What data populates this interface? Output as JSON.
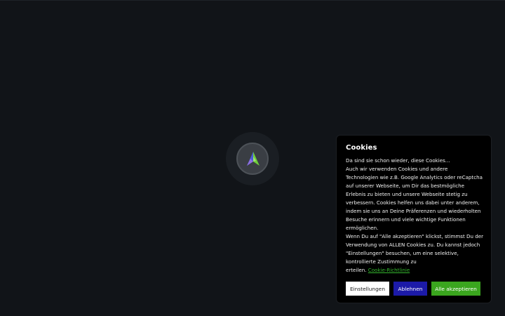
{
  "cookie_banner": {
    "title": "Cookies",
    "lines": [
      "Da sind sie schon wieder, diese Cookies...",
      "Auch wir verwenden Cookies und andere",
      "Technologien wie z.B. Google Analytics oder reCaptcha",
      "auf unserer Webseite, um Dir das bestmögliche",
      "Erlebnis zu bieten und unsere Webseite stetig zu",
      "verbessern. Cookies helfen uns dabei unter anderem,",
      "indem sie uns an Deine Präferenzen und wiederholten",
      "Besuche erinnern und viele wichtige Funktionen",
      "ermöglichen.",
      "Wenn Du auf \"Alle akzeptieren\" klickst, stimmst Du der",
      "Verwendung von ALLEN Cookies zu. Du kannst jedoch",
      "\"Einstellungen\" besuchen, um eine selektive,",
      "kontrollierte Zustimmung zu"
    ],
    "last_line_prefix": "erteilen.",
    "policy_link": "Cookie-Richtlinie",
    "buttons": {
      "settings": "Einstellungen",
      "reject": "Ablehnen",
      "accept_all": "Alle akzeptieren"
    }
  },
  "loader": {
    "icon": "brand-logo-icon"
  },
  "colors": {
    "background": "#111418",
    "banner": "#000000",
    "accept": "#3aa61e",
    "reject": "#1c1aa8",
    "link": "#35b72e"
  }
}
